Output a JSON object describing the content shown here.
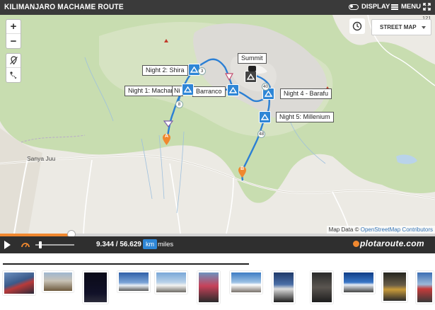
{
  "header": {
    "title": "KILIMANJARO MACHAME ROUTE",
    "display_label": "DISPLAY",
    "menu_label": "MENU",
    "fullscreen_icon": "expand-icon"
  },
  "map": {
    "zoom_in": "+",
    "zoom_out": "−",
    "layer_label": "STREET MAP",
    "clock_icon": "clock-icon",
    "place_labels": [
      "Sanya Juu",
      "121"
    ],
    "camps": [
      {
        "label": "Night 1: Machame"
      },
      {
        "label": "Night 2: Shira"
      },
      {
        "label": "Barranco"
      },
      {
        "label": "Summit"
      },
      {
        "label": "Night 4 - Barafu"
      },
      {
        "label": "Night 5: Millenium"
      }
    ],
    "mile_markers": [
      "8",
      "40",
      "48",
      "3"
    ],
    "start_marker": "A",
    "end_marker": "B",
    "attribution_prefix": "Map Data ©",
    "attribution_link": "OpenStreetMap Contributors",
    "colors": {
      "route": "#2b7fd4",
      "poi": "#2e86d6",
      "marker": "#f0882f"
    }
  },
  "player": {
    "progress_fraction": 0.165,
    "distance": "9.344 / 56.629",
    "unit_active": "km",
    "unit_other": "miles",
    "brand": "plotaroute.com"
  },
  "photos": {
    "count": 14
  }
}
